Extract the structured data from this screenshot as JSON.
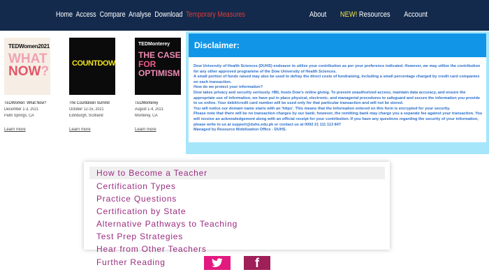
{
  "topnav": {
    "left_items": [
      "Home",
      "Access",
      "Compare",
      "Analyse",
      "Download"
    ],
    "warning_item": "Temporary Measures",
    "about": "About",
    "new_badge": "NEW!",
    "resources": "Resources",
    "account": "Account"
  },
  "events": [
    {
      "thumb_lines": [
        "TEDWomen2021",
        "WHAT",
        "NOW",
        "?"
      ],
      "title": "TEDWomen: What Now?",
      "date": "December 1-3, 2021",
      "location": "Palm Springs, CA",
      "link": "Learn more"
    },
    {
      "thumb_lines": [
        "COUNTDOWN"
      ],
      "title": "The Countdown Summit",
      "date": "October 12-15, 2021",
      "location": "Edinburgh, Scotland",
      "link": "Learn more"
    },
    {
      "thumb_lines": [
        "TEDMonterey",
        "THE CASE",
        "FOR",
        "OPTIMISM"
      ],
      "title": "TEDMonterey",
      "date": "August 1-4, 2021",
      "location": "Monterey, CA",
      "link": "Learn more"
    }
  ],
  "disclaimer": {
    "title": "Disclaimer:",
    "paragraphs": [
      "Dow University of Health Sciences (DUHS) endeavor to utilize your contribution as per your preference indicated. However, we may utilize the contribution for any other approved programme of the Dow University of Health Sciences.",
      "A small portion of funds raised may also be used to defray the direct costs of fundraising, including a small percentage charged by credit card companies on each transaction.",
      "How do we protect your information?",
      "Dow takes privacy and security seriously. HBL hosts Dow's online giving. To prevent unauthorized access, maintain data accuracy, and ensure the appropriate use of information, we have put in place physical, electronic, and managerial procedures to safeguard and secure the information you provide to us online. Your debit/credit card number will be used only for that particular transaction and will not be stored.",
      "You will notice our domain name starts with an 'https'. This means that the information entered on this form is encrypted for your security.",
      "Please note that there will be no transaction charges by our bank; however, the remitting bank may charge you a separate fee against your transaction. You will receive an acknowledgement along with an official receipt for your contribution. If you have any questions regarding the security of your information, please write to us at support@duhs.edu.pk or contact us at 0092 21 111 113 847",
      "Managed by Resource Mobilization Office - DUHS."
    ]
  },
  "teacher_menu": {
    "items": [
      "How to Become a Teacher",
      "Certification Types",
      "Practice Questions",
      "Certification by State",
      "Alternative Pathways to Teaching",
      "Test Prep Strategies",
      "Hear from Other Teachers",
      "Further Reading"
    ],
    "twitter_icon": "twitter-icon",
    "facebook_icon": "facebook-icon",
    "facebook_glyph": "f"
  },
  "colors": {
    "nav_bg": "#132a4c",
    "warning": "#e53935",
    "new_badge": "#f1e04a",
    "disclaimer_header": "#1196e7",
    "disclaimer_bg": "#a6e6fb",
    "menu_text": "#9a2c80",
    "twitter": "#e2197f",
    "facebook": "#9f1f58"
  }
}
